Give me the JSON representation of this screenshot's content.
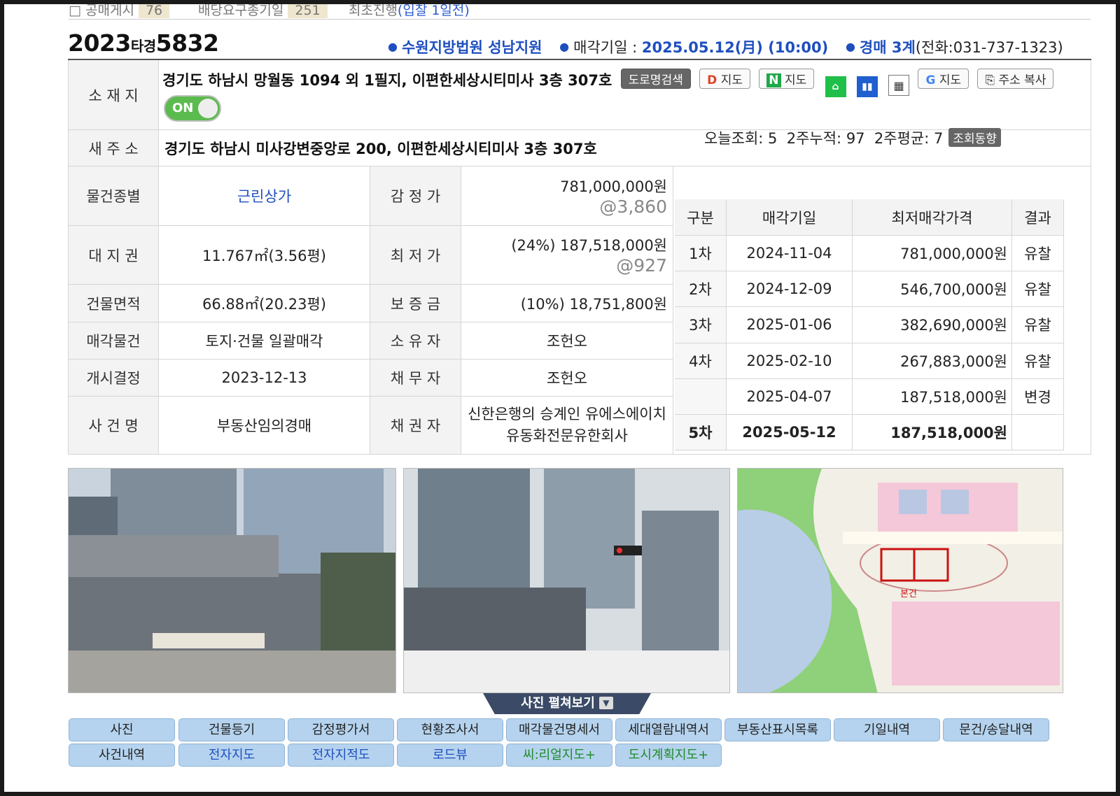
{
  "top_strip": {
    "item1_label": "공매게시",
    "item1_count": "76",
    "item2_label": "배당요구종기일",
    "item2_count": "251",
    "item3_label": "최초진행",
    "item3_sub": "(입찰 1일전)"
  },
  "header": {
    "case_year": "2023",
    "case_type": "타경",
    "case_no": "5832",
    "court": "수원지방법원 성남지원",
    "sale_date_label": "매각기일 : ",
    "sale_date": "2025.05.12(月) (10:00)",
    "dept": "경매 3계",
    "phone": "(전화:031-737-1323)"
  },
  "location": {
    "label": "소 재 지",
    "address": "경기도 하남시 망월동 1094 외 1필지, 이편한세상시티미사 3층 307호",
    "buttons": [
      "도로명검색",
      "지도",
      "지도",
      "지도",
      "주소 복사"
    ],
    "toggle": "ON"
  },
  "new_address": {
    "label": "새 주 소",
    "value": "경기도 하남시 미사강변중앙로 200, 이편한세상시티미사 3층 307호"
  },
  "rows": [
    {
      "l1": "물건종별",
      "v1": "근린상가",
      "l2": "감 정 가",
      "v2": "781,000,000원",
      "v2b": "@3,860"
    },
    {
      "l1": "대 지 권",
      "v1": "11.767㎡(3.56평)",
      "l2": "최 저 가",
      "v2": "(24%) 187,518,000원",
      "v2b": "@927"
    },
    {
      "l1": "건물면적",
      "v1": "66.88㎡(20.23평)",
      "l2": "보 증 금",
      "v2": "(10%) 18,751,800원",
      "v2b": ""
    },
    {
      "l1": "매각물건",
      "v1": "토지·건물 일괄매각",
      "l2": "소 유 자",
      "v2": "조헌오",
      "v2b": ""
    },
    {
      "l1": "개시결정",
      "v1": "2023-12-13",
      "l2": "채 무 자",
      "v2": "조헌오",
      "v2b": ""
    },
    {
      "l1": "사 건 명",
      "v1": "부동산임의경매",
      "l2": "채 권 자",
      "v2": "신한은행의 승계인 유에스에이치",
      "v2b": "유동화전문유한회사"
    }
  ],
  "views": {
    "text": "오늘조회: 5  2주누적: 97  2주평균: 7",
    "button": "조회동향"
  },
  "history": {
    "headers": [
      "구분",
      "매각기일",
      "최저매각가격",
      "결과"
    ],
    "rows": [
      {
        "round": "1차",
        "date": "2024-11-04",
        "price": "781,000,000원",
        "result": "유찰"
      },
      {
        "round": "2차",
        "date": "2024-12-09",
        "price": "546,700,000원",
        "result": "유찰"
      },
      {
        "round": "3차",
        "date": "2025-01-06",
        "price": "382,690,000원",
        "result": "유찰"
      },
      {
        "round": "4차",
        "date": "2025-02-10",
        "price": "267,883,000원",
        "result": "유찰"
      },
      {
        "round": "",
        "date": "2025-04-07",
        "price": "187,518,000원",
        "result": "변경"
      },
      {
        "round": "5차",
        "date": "2025-05-12",
        "price": "187,518,000원",
        "result": ""
      }
    ]
  },
  "photos": {
    "expand_label": "사진 펼쳐보기",
    "map_label": "본건"
  },
  "nav": {
    "row1": [
      "사진",
      "건물등기",
      "감정평가서",
      "현황조사서",
      "매각물건명세서",
      "세대열람내역서",
      "부동산표시목록",
      "기일내역",
      "문건/송달내역"
    ],
    "row2": [
      "사건내역",
      "전자지도",
      "전자지적도",
      "로드뷰",
      "씨:리얼지도+",
      "도시계획지도+"
    ]
  }
}
